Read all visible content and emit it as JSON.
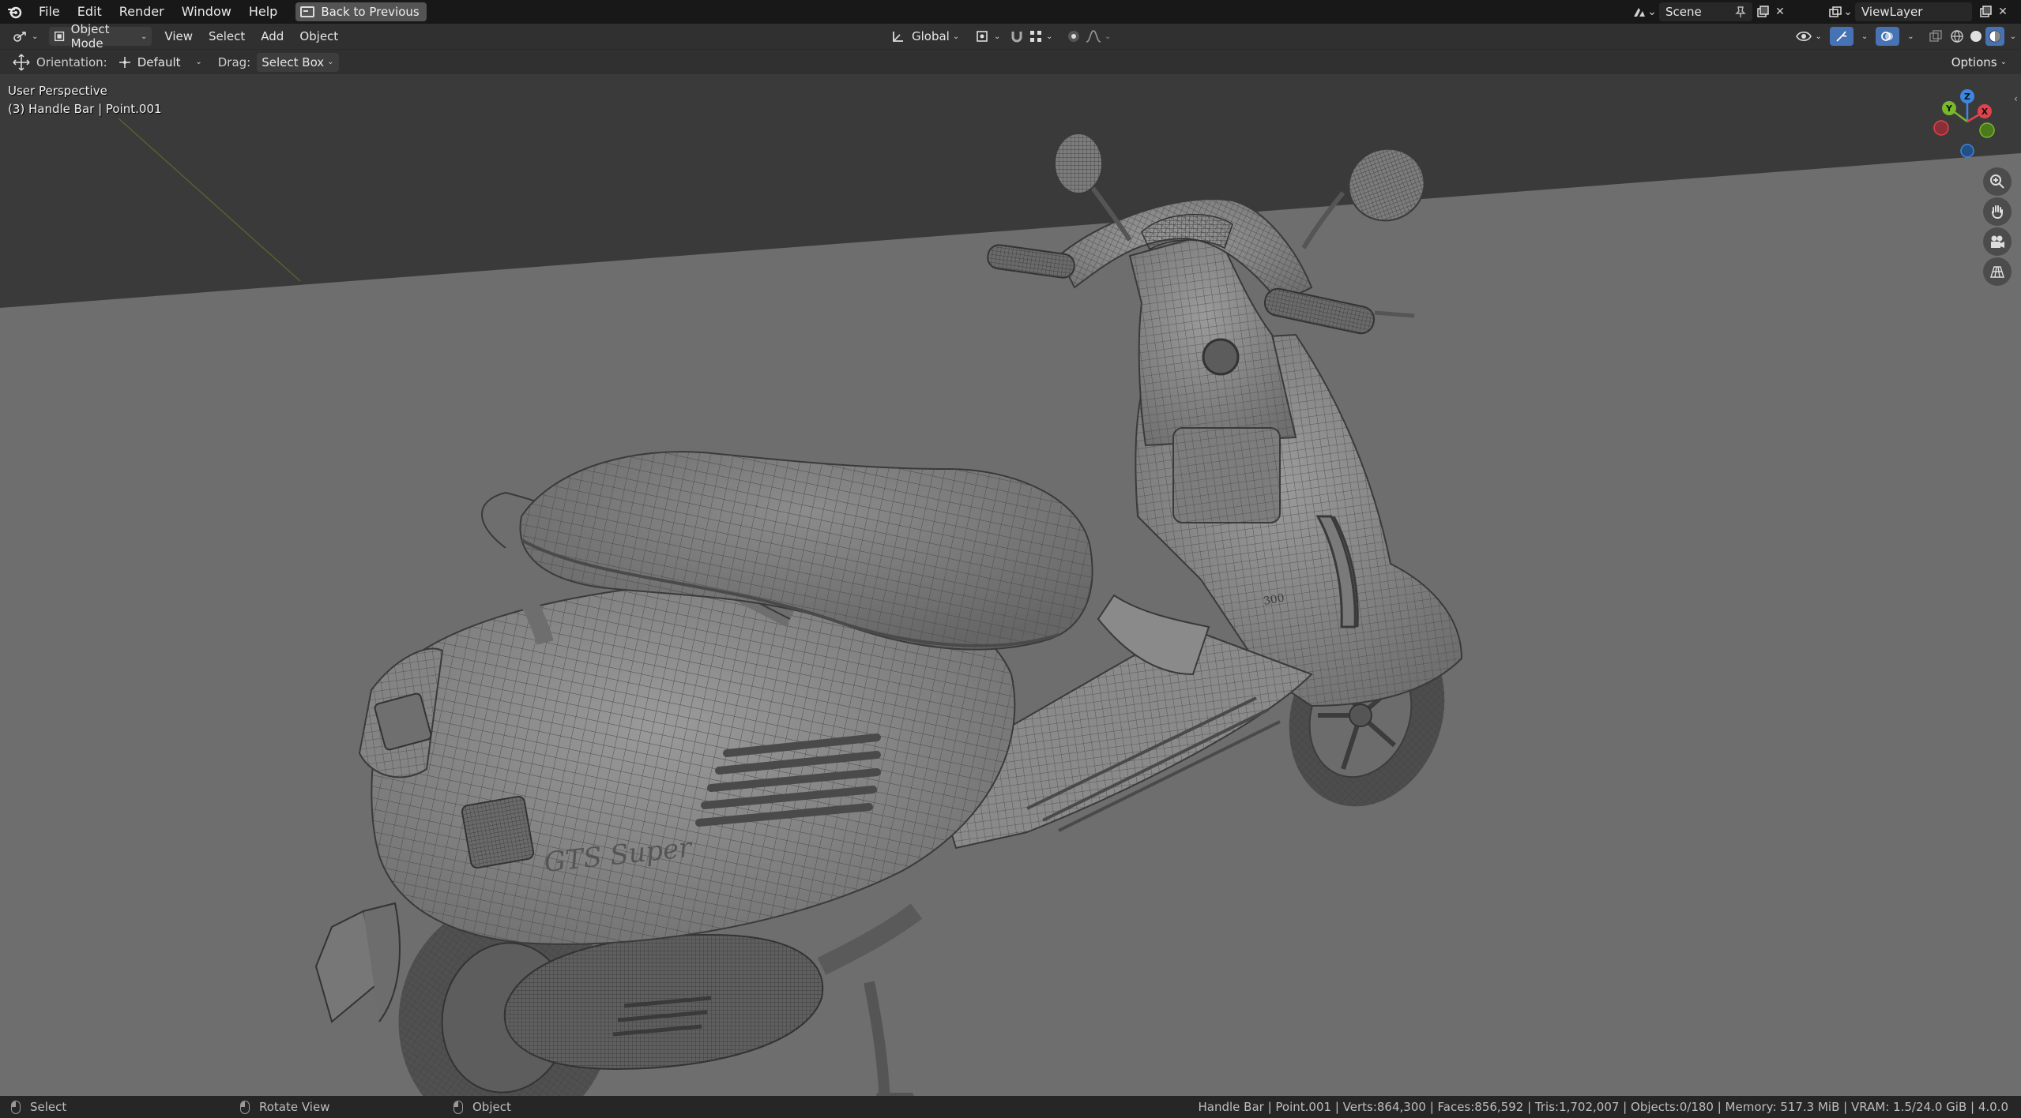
{
  "topbar": {
    "menus": [
      "File",
      "Edit",
      "Render",
      "Window",
      "Help"
    ],
    "back_button": "Back to Previous",
    "scene_name": "Scene",
    "view_layer": "ViewLayer"
  },
  "header": {
    "mode": "Object Mode",
    "menus": [
      "View",
      "Select",
      "Add",
      "Object"
    ],
    "transform_orientation": "Global"
  },
  "toolbar": {
    "orientation_label": "Orientation:",
    "orientation_value": "Default",
    "drag_label": "Drag:",
    "drag_value": "Select Box",
    "options_label": "Options"
  },
  "viewport": {
    "perspective": "User Perspective",
    "active_object": "(3) Handle Bar | Point.001",
    "gizmo_axes": {
      "z": "Z",
      "y": "Y",
      "x": "X"
    },
    "model_text": "GTS Super"
  },
  "statusbar": {
    "left_items": [
      "Select",
      "Rotate View",
      "Object"
    ],
    "stats": "Handle Bar | Point.001 | Verts:864,300 | Faces:856,592 | Tris:1,702,007 | Objects:0/180 | Memory: 517.3 MiB | VRAM: 1.5/24.0 GiB | 4.0.0"
  },
  "colors": {
    "accent_blue": "#4772b3",
    "axis_x": "#e0434e",
    "axis_y": "#79b82a",
    "axis_z": "#3c87e0",
    "floor": "#6e6e6e",
    "sky": "#3a3a3a",
    "wire": "#3c3c3c"
  }
}
